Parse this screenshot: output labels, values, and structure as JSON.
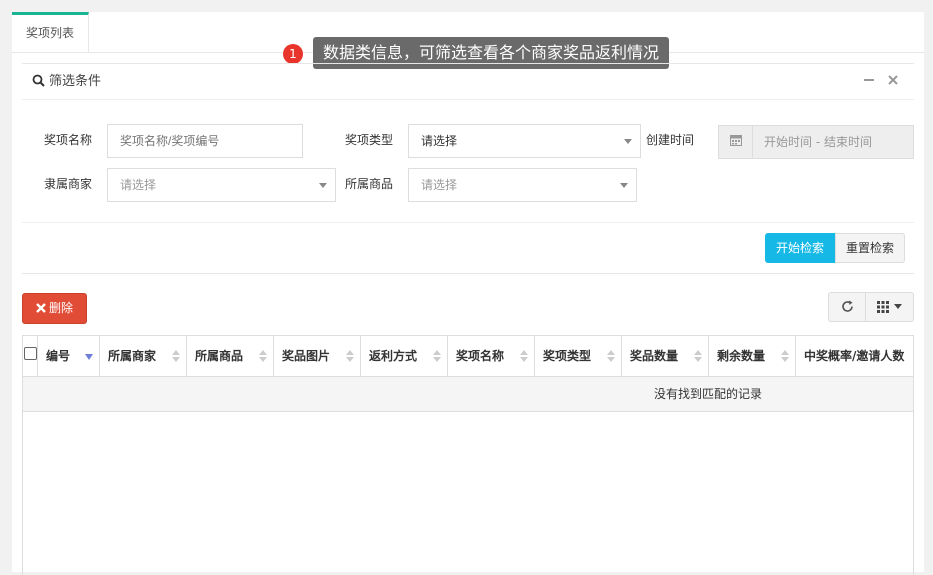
{
  "tabs": [
    {
      "label": "奖项列表",
      "active": true
    }
  ],
  "hint": {
    "badge": "1",
    "text": "数据类信息，可筛选查看各个商家奖品返利情况"
  },
  "filter": {
    "title": "筛选条件",
    "collapse_icon": "minus-icon",
    "close_icon": "close-icon",
    "fields": {
      "award_name": {
        "label": "奖项名称",
        "placeholder": "奖项名称/奖项编号",
        "value": ""
      },
      "award_type": {
        "label": "奖项类型",
        "value": "请选择"
      },
      "created_time": {
        "label": "创建时间",
        "placeholder": "开始时间 - 结束时间"
      },
      "merchant": {
        "label": "隶属商家",
        "value": "请选择"
      },
      "product": {
        "label": "所属商品",
        "value": "请选择"
      }
    },
    "search_button": "开始检索",
    "reset_button": "重置检索"
  },
  "toolbar": {
    "delete_button": "删除",
    "refresh_icon": "refresh-icon",
    "columns_icon": "grid-icon"
  },
  "table": {
    "columns": [
      "编号",
      "所属商家",
      "所属商品",
      "奖品图片",
      "返利方式",
      "奖项名称",
      "奖项类型",
      "奖品数量",
      "剩余数量",
      "中奖概率/邀请人数"
    ],
    "empty_text": "没有找到匹配的记录"
  },
  "colors": {
    "accent_green": "#1ab394",
    "search_blue": "#16b9e6",
    "delete_red": "#e04c36",
    "hint_badge_red": "#e9342b"
  }
}
